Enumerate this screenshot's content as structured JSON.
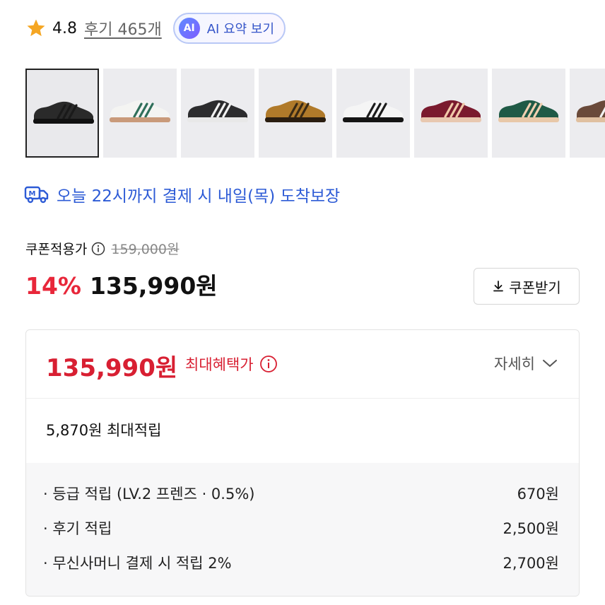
{
  "rating": {
    "value": "4.8",
    "review_link": "후기 465개"
  },
  "ai_summary": {
    "badge": "AI",
    "label": "AI 요약 보기"
  },
  "thumbnails": [
    {
      "name": "black",
      "body": "#2a2a2a",
      "stripe": "#1a1a1a",
      "sole": "#111111"
    },
    {
      "name": "white-green",
      "body": "#f4f4f2",
      "stripe": "#2f6f5a",
      "sole": "#c99a7a"
    },
    {
      "name": "black-white",
      "body": "#2c2c2e",
      "stripe": "#f2f2f2",
      "sole": "#e8e8e8"
    },
    {
      "name": "brown",
      "body": "#b07a2a",
      "stripe": "#3a2a14",
      "sole": "#2a1d10"
    },
    {
      "name": "white-black",
      "body": "#f5f5f5",
      "stripe": "#1c1c1c",
      "sole": "#141414"
    },
    {
      "name": "burgundy",
      "body": "#7a1a2e",
      "stripe": "#f0c8a8",
      "sole": "#e8c8b0"
    },
    {
      "name": "green",
      "body": "#1f5a46",
      "stripe": "#f0d0b0",
      "sole": "#e8c8a8"
    },
    {
      "name": "brown-white",
      "body": "#6a4a3a",
      "stripe": "#f2f2f2",
      "sole": "#e0c0a0"
    }
  ],
  "delivery": {
    "text": "오늘 22시까지 결제 시 내일(목) 도착보장"
  },
  "price": {
    "coupon_label": "쿠폰적용가",
    "original": "159,000원",
    "discount": "14%",
    "final": "135,990원",
    "coupon_button": "쿠폰받기"
  },
  "benefit": {
    "max_price": "135,990원",
    "max_label": "최대혜택가",
    "detail_toggle": "자세히",
    "points_total": "5,870원 최대적립",
    "rows": [
      {
        "label": "· 등급 적립 (LV.2 프렌즈 · 0.5%)",
        "amount": "670원"
      },
      {
        "label": "· 후기 적립",
        "amount": "2,500원"
      },
      {
        "label": "· 무신사머니 결제 시 적립 2%",
        "amount": "2,700원"
      }
    ]
  },
  "colors": {
    "accent_red": "#e8273a",
    "link_blue": "#2d5bd6",
    "star": "#f5a623"
  }
}
